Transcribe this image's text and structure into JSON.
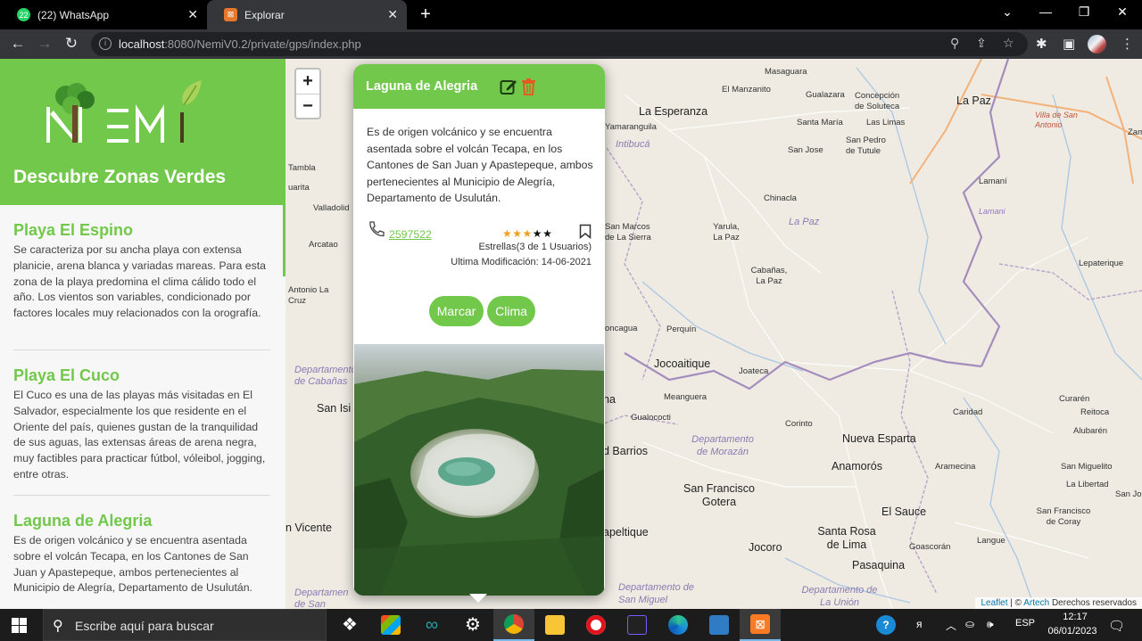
{
  "browser": {
    "tabs": [
      {
        "title": "(22) WhatsApp",
        "badge": "22"
      },
      {
        "title": "Explorar"
      }
    ],
    "url_host": "localhost",
    "url_rest": ":8080/NemiV0.2/private/gps/index.php"
  },
  "sidebar": {
    "tagline": "Descubre Zonas Verdes",
    "places": [
      {
        "name": "Playa El Espino",
        "description": "Se caracteriza por su ancha playa con extensa planicie, arena blanca y variadas mareas. Para esta zona de la playa predomina el clima cálido todo el año. Los vientos son variables, condicionado por factores locales muy relacionados con la orografía."
      },
      {
        "name": "Playa El Cuco",
        "description": "El Cuco es una de las playas más visitadas en El Salvador, especialmente los que residente en el Oriente del país, quienes gustan de la tranquilidad de sus aguas, las extensas áreas de arena negra, muy factibles para practicar fútbol, vóleibol, jogging, entre otras."
      },
      {
        "name": "Laguna de Alegria",
        "description": "Es de origen volcánico y se encuentra asentada sobre el volcán Tecapa, en los Cantones de San Juan y Apastepeque, ambos pertenecientes al Municipio de Alegría, Departamento de Usulután."
      }
    ]
  },
  "map": {
    "zoom_in": "+",
    "zoom_out": "−",
    "labels": {
      "masaguara": "Masaguara",
      "el_manzanito": "El Manzanito",
      "gualazara": "Gualazara",
      "concepcion": "Concepción de Soluteca",
      "la_paz_top": "La Paz",
      "villa_san_antonio": "Villa de San Antonio",
      "la_esperanza": "La Esperanza",
      "yamaranguila": "Yamaranguila",
      "intibuca": "Intibucá",
      "santa_maria": "Santa María",
      "las_limas": "Las Limas",
      "san_pedro_tutule": "San Pedro de Tutule",
      "san_jose": "San Jose",
      "zamb": "Zamb",
      "tambla": "Tambla",
      "valladolid": "Valladolid",
      "chinacla": "Chinacla",
      "lamani": "Lamaní",
      "lamani_water": "Lamani",
      "arcatao": "Arcatao",
      "san_marcos_sierra": "San Marcos de La Sierra",
      "yarula": "Yarula, La Paz",
      "la_paz_region": "La Paz",
      "lepaterique": "Lepaterique",
      "cabanas": "Cabañas, La Paz",
      "antonio_cruz": "Antonio La Cruz",
      "uarita": "uarita",
      "concagua": "oncagua",
      "perquin": "Perquín",
      "jocoaitique": "Jocoaitique",
      "joateca": "Joateca",
      "dep_cabanas": "Departamento de Cabañas",
      "meanguera": "Meanguera",
      "san_isidro": "San Isi",
      "na": "na",
      "guatajiagua": "Gualococti",
      "corinto": "Corinto",
      "caridad": "Caridad",
      "curaren": "Curarén",
      "reitoca": "Reitoca",
      "alubaren": "Alubarén",
      "dep_morazan": "Departamento de Morazán",
      "nueva_esparta": "Nueva Esparta",
      "barrios": "d Barrios",
      "anamoros": "Anamorós",
      "aramecina": "Aramecina",
      "san_miguelito": "San Miguelito",
      "la_libertad": "La Libertad",
      "san_francisco_gotera": "San Francisco Gotera",
      "san_jos": "San Jos",
      "n_vicente": "n Vicente",
      "apeltique": "apeltique",
      "el_sauce": "El Sauce",
      "san_francisco_coray": "San Francisco de Coray",
      "santa_rosa_lima": "Santa Rosa de Lima",
      "jocoro": "Jocoro",
      "goascoran": "Goascorán",
      "langue": "Langue",
      "pasaquina": "Pasaquina",
      "dep_san_miguel": "Departamento de San Miguel",
      "dep_la_union": "Departamento de La Unión",
      "dep_vicente": "Departamen de San Vicente"
    },
    "attribution": {
      "leaflet": "Leaflet",
      "sep": " | © ",
      "artech": "Artech",
      "rights": " Derechos reservados"
    }
  },
  "popup": {
    "title": "Laguna de Alegria",
    "description": "Es de origen volcánico y se encuentra asentada sobre el volcán Tecapa, en los Cantones de San Juan y Apastepeque, ambos pertenecientes al Municipio de Alegría, Departamento de Usulután.",
    "phone": "2597522",
    "rating": 3,
    "rating_max": 5,
    "stars_text": "Estrellas(3 de 1 Usuarios)",
    "modified_text": "Ultima Modificación: 14-06-2021",
    "btn_marcar": "Marcar",
    "btn_clima": "Clima",
    "accent_color": "#72c84b"
  },
  "taskbar": {
    "search_placeholder": "Escribe aquí para buscar",
    "lang": "ESP",
    "time": "12:17",
    "date": "06/01/2023"
  }
}
